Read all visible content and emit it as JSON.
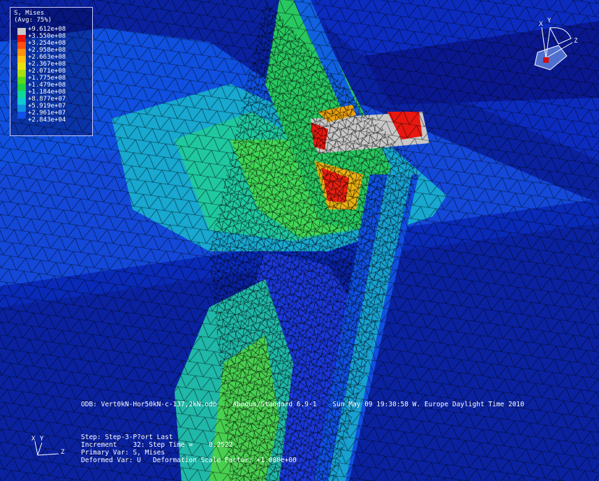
{
  "legend": {
    "title": "S, Mises",
    "subtitle": "(Avg: 75%)",
    "entries": [
      {
        "value": "+9.612e+08",
        "color": "#c8c8c8"
      },
      {
        "value": "+3.550e+08",
        "color": "#e8120a"
      },
      {
        "value": "+3.254e+08",
        "color": "#ff5010"
      },
      {
        "value": "+2.958e+08",
        "color": "#ff9010"
      },
      {
        "value": "+2.663e+08",
        "color": "#ffc010"
      },
      {
        "value": "+2.367e+08",
        "color": "#e8e010"
      },
      {
        "value": "+2.071e+08",
        "color": "#a8e010"
      },
      {
        "value": "+1.775e+08",
        "color": "#58d818"
      },
      {
        "value": "+1.479e+08",
        "color": "#20d040"
      },
      {
        "value": "+1.184e+08",
        "color": "#10d898"
      },
      {
        "value": "+8.877e+07",
        "color": "#10c8d0"
      },
      {
        "value": "+5.919e+07",
        "color": "#1090e0"
      },
      {
        "value": "+2.961e+07",
        "color": "#1050e8"
      },
      {
        "value": "+2.843e+04",
        "color": "#1020d8"
      }
    ]
  },
  "odb_line": "ODB: Vert0kN-Hor50kN-c-137,2kN.odb    Abaqus/Standard 6.9-1    Sun May 09 19:30:58 W. Europe Daylight Time 2010",
  "step_info": {
    "step": "Step: Step-3-P?ort Last",
    "increment": "Increment    32: Step Time =    0.2522",
    "primary_var": "Primary Var: S, Mises",
    "deformed_var": "Deformed Var: U   Deformation Scale Factor: +1.000e+00"
  },
  "triad_labels": {
    "x": "X",
    "y": "Y",
    "z": "Z"
  },
  "colors": {
    "background": "#0a1a8a",
    "mesh_line": "#000000",
    "marker": "#d01010"
  }
}
